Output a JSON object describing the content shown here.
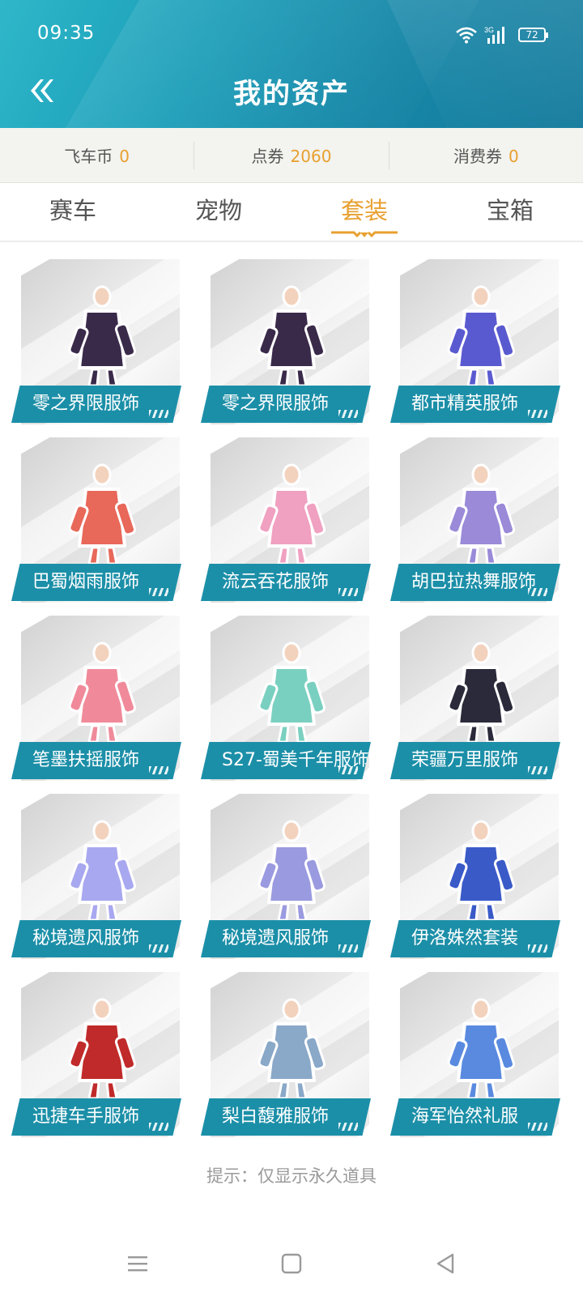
{
  "status": {
    "time": "09:35",
    "network": "3G",
    "battery": "72"
  },
  "header": {
    "title": "我的资产"
  },
  "assets": [
    {
      "label": "飞车币",
      "value": "0"
    },
    {
      "label": "点券",
      "value": "2060"
    },
    {
      "label": "消费券",
      "value": "0"
    }
  ],
  "tabs": [
    {
      "label": "赛车",
      "active": false
    },
    {
      "label": "宠物",
      "active": false
    },
    {
      "label": "套装",
      "active": true
    },
    {
      "label": "宝箱",
      "active": false
    }
  ],
  "items": [
    {
      "name": "零之界限服饰",
      "icon": "dark-armor-outfit-icon",
      "color": "#3a2a4a"
    },
    {
      "name": "零之界限服饰",
      "icon": "dark-armor-outfit-icon",
      "color": "#3a2a4a"
    },
    {
      "name": "都市精英服饰",
      "icon": "blue-dress-outfit-icon",
      "color": "#5a5ad0"
    },
    {
      "name": "巴蜀烟雨服饰",
      "icon": "red-dress-outfit-icon",
      "color": "#e8685a"
    },
    {
      "name": "流云吞花服饰",
      "icon": "pink-dress-outfit-icon",
      "color": "#f0a0c0"
    },
    {
      "name": "胡巴拉热舞服饰",
      "icon": "purple-dance-outfit-icon",
      "color": "#9a8ad8"
    },
    {
      "name": "笔墨扶摇服饰",
      "icon": "pink-robe-outfit-icon",
      "color": "#f08a9a"
    },
    {
      "name": "S27-蜀美千年服饰",
      "icon": "mint-suit-outfit-icon",
      "color": "#7ad0c0"
    },
    {
      "name": "荣疆万里服饰",
      "icon": "black-gown-outfit-icon",
      "color": "#2a2a3a"
    },
    {
      "name": "秘境遗风服饰",
      "icon": "lavender-dress-outfit-icon",
      "color": "#a8a8f0"
    },
    {
      "name": "秘境遗风服饰",
      "icon": "lavender-suit-outfit-icon",
      "color": "#9a9ae0"
    },
    {
      "name": "伊洛姝然套装",
      "icon": "blonde-girl-outfit-icon",
      "color": "#3a5ac8"
    },
    {
      "name": "迅捷车手服饰",
      "icon": "racer-jacket-outfit-icon",
      "color": "#c02a2a"
    },
    {
      "name": "梨白馥雅服饰",
      "icon": "white-suit-outfit-icon",
      "color": "#8aa8c8"
    },
    {
      "name": "海军怡然礼服",
      "icon": "navy-dress-outfit-icon",
      "color": "#5a8ae0"
    }
  ],
  "hint": "提示：仅显示永久道具",
  "nav": {
    "menu_icon": "menu-icon",
    "home_icon": "home-icon",
    "back_icon": "back-triangle-icon"
  }
}
